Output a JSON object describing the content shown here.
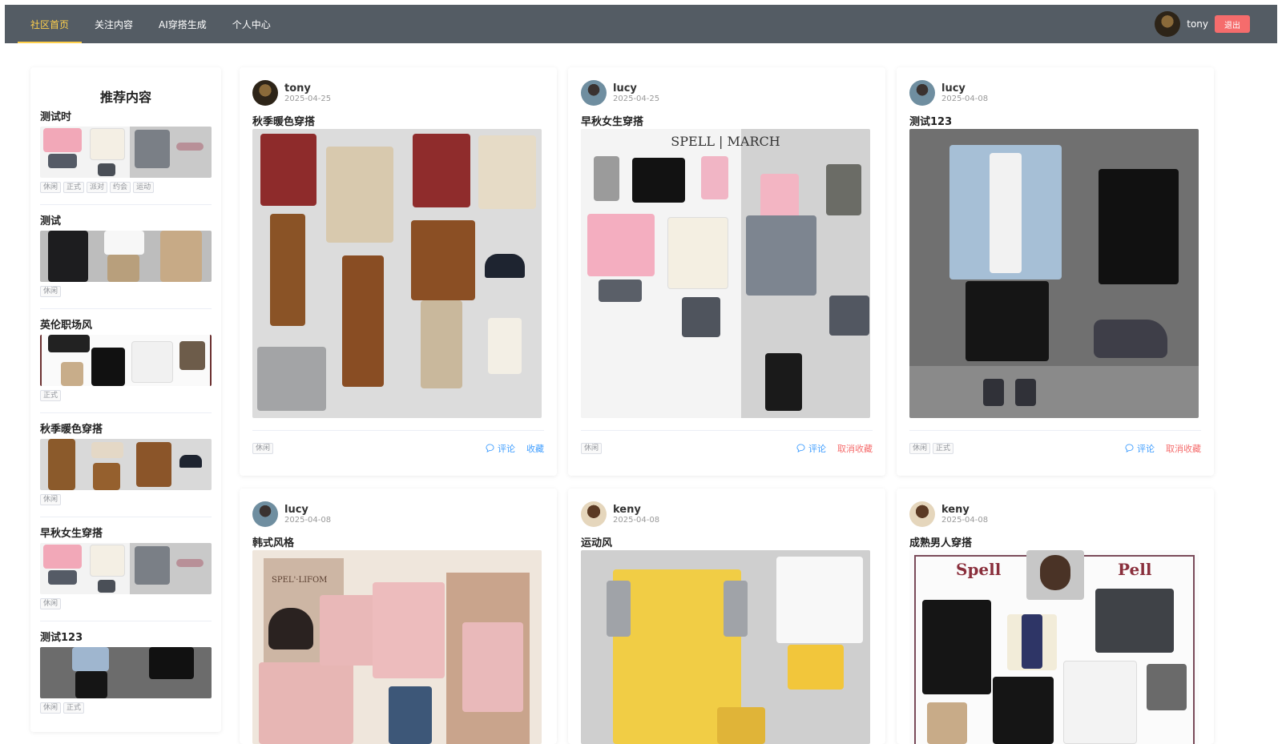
{
  "nav": {
    "items": [
      "社区首页",
      "关注内容",
      "AI穿搭生成",
      "个人中心"
    ],
    "active_index": 0,
    "username": "tony",
    "logout_label": "退出",
    "bg_color": "#545c64",
    "active_color": "#ffd04b"
  },
  "sidebar": {
    "title": "推荐内容",
    "items": [
      {
        "title": "测试时",
        "tags": [
          "休闲",
          "正式",
          "派对",
          "约会",
          "运动"
        ]
      },
      {
        "title": "测试",
        "tags": [
          "休闲"
        ]
      },
      {
        "title": "英伦职场风",
        "tags": [
          "正式"
        ]
      },
      {
        "title": "秋季暖色穿搭",
        "tags": [
          "休闲"
        ]
      },
      {
        "title": "早秋女生穿搭",
        "tags": [
          "休闲"
        ]
      },
      {
        "title": "测试123",
        "tags": [
          "休闲",
          "正式"
        ]
      }
    ]
  },
  "posts": [
    {
      "author": "tony",
      "date": "2025-04-25",
      "title": "秋季暖色穿搭",
      "tags": [
        "休闲"
      ],
      "comment_label": "评论",
      "fav_label": "收藏",
      "favorited": false
    },
    {
      "author": "lucy",
      "date": "2025-04-25",
      "title": "早秋女生穿搭",
      "tags": [
        "休闲"
      ],
      "comment_label": "评论",
      "fav_label": "取消收藏",
      "favorited": true,
      "image_text": "SPELL | MARCH"
    },
    {
      "author": "lucy",
      "date": "2025-04-08",
      "title": "测试123",
      "tags": [
        "休闲",
        "正式"
      ],
      "comment_label": "评论",
      "fav_label": "取消收藏",
      "favorited": true
    },
    {
      "author": "lucy",
      "date": "2025-04-08",
      "title": "韩式风格",
      "image_text": "SPEL'·LIFOM"
    },
    {
      "author": "keny",
      "date": "2025-04-08",
      "title": "运动风"
    },
    {
      "author": "keny",
      "date": "2025-04-08",
      "title": "成熟男人穿搭",
      "image_text_left": "Spell",
      "image_text_right": "Pell"
    }
  ],
  "colors": {
    "primary": "#409eff",
    "danger": "#f56c6c"
  }
}
